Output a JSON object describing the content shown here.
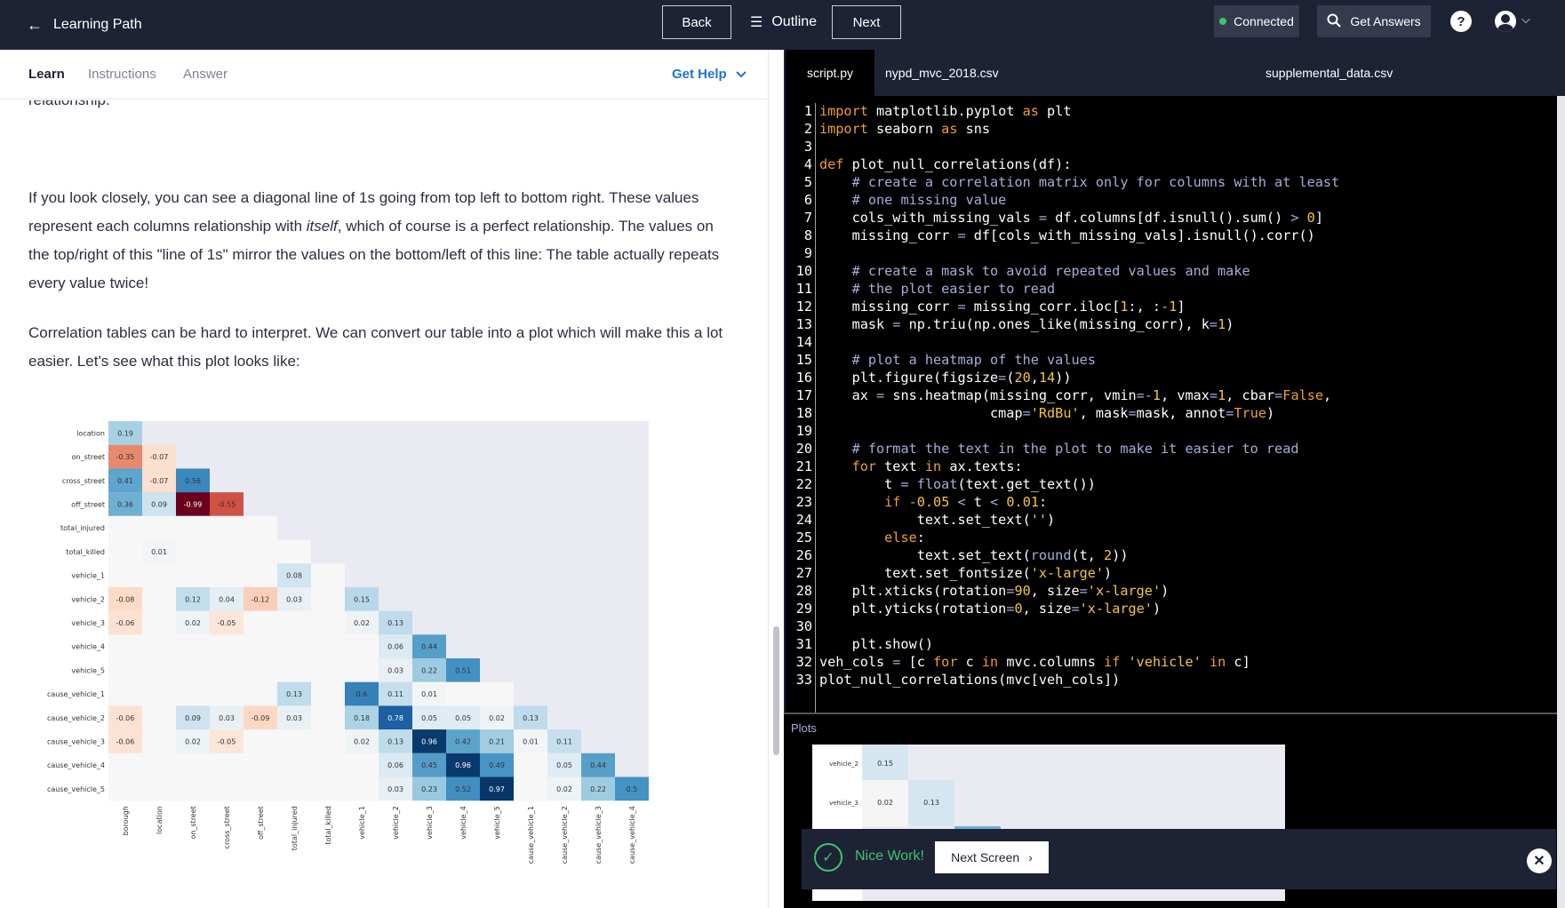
{
  "topbar": {
    "learning_path": "Learning Path",
    "back": "Back",
    "outline": "Outline",
    "next": "Next",
    "connected": "Connected",
    "get_answers": "Get Answers",
    "help": "?"
  },
  "tabs": {
    "learn": "Learn",
    "instructions": "Instructions",
    "answer": "Answer",
    "get_help": "Get Help"
  },
  "content": {
    "clipped_line": "relationship.",
    "para1_a": "If you look closely, you can see a diagonal line of 1s going from top left to bottom right. These values represent each columns relationship with ",
    "para1_em": "itself",
    "para1_b": ", which of course is a perfect relationship. The values on the top/right of this \"line of 1s\" mirror the values on the bottom/left of this line: The table actually repeats every value twice!",
    "para2": "Correlation tables can be hard to interpret. We can convert our table into a plot which will make this a lot easier. Let's see what this plot looks like:"
  },
  "files": {
    "tab1": "script.py",
    "tab2": "nypd_mvc_2018.csv",
    "tab3": "supplemental_data.csv"
  },
  "plots_label": "Plots",
  "toast": {
    "message": "Nice Work!",
    "next_screen": "Next Screen"
  },
  "chart_data": {
    "type": "heatmap",
    "rows": [
      "location",
      "on_street",
      "cross_street",
      "off_street",
      "total_injured",
      "total_killed",
      "vehicle_1",
      "vehicle_2",
      "vehicle_3",
      "vehicle_4",
      "vehicle_5",
      "cause_vehicle_1",
      "cause_vehicle_2",
      "cause_vehicle_3",
      "cause_vehicle_4",
      "cause_vehicle_5"
    ],
    "cols": [
      "borough",
      "location",
      "on_street",
      "cross_street",
      "off_street",
      "total_injured",
      "total_killed",
      "vehicle_1",
      "vehicle_2",
      "vehicle_3",
      "vehicle_4",
      "vehicle_5",
      "cause_vehicle_1",
      "cause_vehicle_2",
      "cause_vehicle_3",
      "cause_vehicle_4"
    ],
    "values": [
      [
        0.19
      ],
      [
        -0.35,
        -0.07
      ],
      [
        0.41,
        -0.07,
        0.56
      ],
      [
        0.36,
        0.09,
        -0.99,
        -0.55
      ],
      [
        0,
        0,
        0,
        0,
        0
      ],
      [
        0,
        0.01,
        0,
        0,
        0,
        0
      ],
      [
        0,
        0,
        0,
        0,
        0,
        0.08,
        0
      ],
      [
        -0.08,
        0,
        0.12,
        0.04,
        -0.12,
        0.03,
        0,
        0.15
      ],
      [
        -0.06,
        0,
        0.02,
        -0.05,
        0,
        0,
        0,
        0.02,
        0.13
      ],
      [
        0,
        0,
        0,
        0,
        0,
        0,
        0,
        0,
        0.06,
        0.44
      ],
      [
        0,
        0,
        0,
        0,
        0,
        0,
        0,
        0,
        0.03,
        0.22,
        0.51
      ],
      [
        0,
        0,
        0,
        0,
        0,
        0.13,
        0,
        0.6,
        0.11,
        0.01,
        0,
        0
      ],
      [
        -0.06,
        0,
        0.09,
        0.03,
        -0.09,
        0.03,
        0,
        0.18,
        0.78,
        0.05,
        0.05,
        0.02,
        0.13
      ],
      [
        -0.06,
        0,
        0.02,
        -0.05,
        0,
        0,
        0,
        0.02,
        0.13,
        0.96,
        0.42,
        0.21,
        0.01,
        0.11
      ],
      [
        0,
        0,
        0,
        0,
        0,
        0,
        0,
        0,
        0.06,
        0.45,
        0.96,
        0.49,
        0,
        0.05,
        0.44
      ],
      [
        0,
        0,
        0,
        0,
        0,
        0,
        0,
        0,
        0.03,
        0.23,
        0.52,
        0.97,
        0,
        0.02,
        0.22,
        0.5
      ]
    ],
    "labels_shown": [
      [
        "0.19"
      ],
      [
        "-0.35",
        "-0.07"
      ],
      [
        "0.41",
        "-0.07",
        "0.56"
      ],
      [
        "0.36",
        "0.09",
        "-0.99",
        "-0.55"
      ],
      [
        "",
        "",
        "",
        "",
        ""
      ],
      [
        "",
        "0.01",
        "",
        "",
        "",
        ""
      ],
      [
        "",
        "",
        "",
        "",
        "",
        "0.08",
        ""
      ],
      [
        "-0.08",
        "",
        "0.12",
        "0.04",
        "-0.12",
        "0.03",
        "",
        "0.15"
      ],
      [
        "-0.06",
        "",
        "0.02",
        "-0.05",
        "",
        "",
        "",
        "0.02",
        "0.13"
      ],
      [
        "",
        "",
        "",
        "",
        "",
        "",
        "",
        "",
        "0.06",
        "0.44"
      ],
      [
        "",
        "",
        "",
        "",
        "",
        "",
        "",
        "",
        "0.03",
        "0.22",
        "0.51"
      ],
      [
        "",
        "",
        "",
        "",
        "",
        "0.13",
        "",
        "0.6",
        "0.11",
        "0.01",
        "",
        ""
      ],
      [
        "-0.06",
        "",
        "0.09",
        "0.03",
        "-0.09",
        "0.03",
        "",
        "0.18",
        "0.78",
        "0.05",
        "0.05",
        "0.02",
        "0.13"
      ],
      [
        "-0.06",
        "",
        "0.02",
        "-0.05",
        "",
        "",
        "",
        "0.02",
        "0.13",
        "0.96",
        "0.42",
        "0.21",
        "0.01",
        "0.11"
      ],
      [
        "",
        "",
        "",
        "",
        "",
        "",
        "",
        "",
        "0.06",
        "0.45",
        "0.96",
        "0.49",
        "",
        "0.05",
        "0.44"
      ],
      [
        "",
        "",
        "",
        "",
        "",
        "",
        "",
        "",
        "0.03",
        "0.23",
        "0.52",
        "0.97",
        "",
        "0.02",
        "0.22",
        "0.5"
      ]
    ],
    "vmin": -1,
    "vmax": 1,
    "cmap": "RdBu"
  },
  "colors": {
    "topbar": "#1e2235",
    "link": "#1d73d6",
    "success": "#3bc46f",
    "keyword": "#f29e2c",
    "comment": "#a5aed8",
    "string": "#f4c542"
  }
}
